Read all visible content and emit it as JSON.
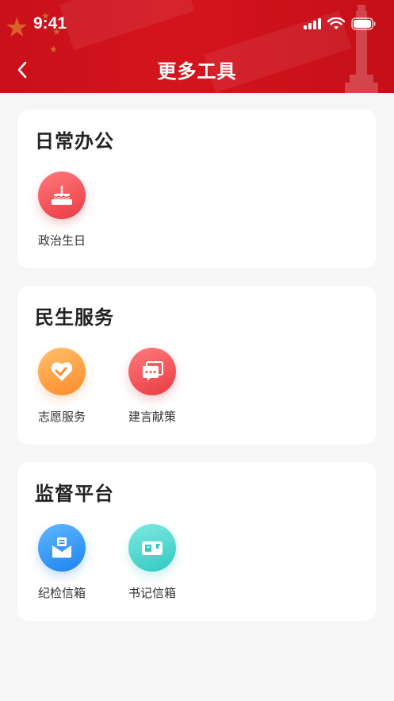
{
  "status_bar": {
    "time": "9:41"
  },
  "nav": {
    "title": "更多工具",
    "back_icon": "chevron-left-icon"
  },
  "colors": {
    "header_red": "#c9101a",
    "icon_red": "#e83b42",
    "icon_orange": "#ff8a2b",
    "icon_blue": "#1f83f0",
    "icon_teal": "#2fc9c0"
  },
  "sections": [
    {
      "title": "日常办公",
      "tools": [
        {
          "label": "政治生日",
          "icon": "birthday-cake-icon"
        }
      ]
    },
    {
      "title": "民生服务",
      "tools": [
        {
          "label": "志愿服务",
          "icon": "heart-handshake-icon"
        },
        {
          "label": "建言献策",
          "icon": "chat-bubbles-icon"
        }
      ]
    },
    {
      "title": "监督平台",
      "tools": [
        {
          "label": "纪检信箱",
          "icon": "envelope-icon"
        },
        {
          "label": "书记信箱",
          "icon": "mailbox-icon"
        }
      ]
    }
  ]
}
